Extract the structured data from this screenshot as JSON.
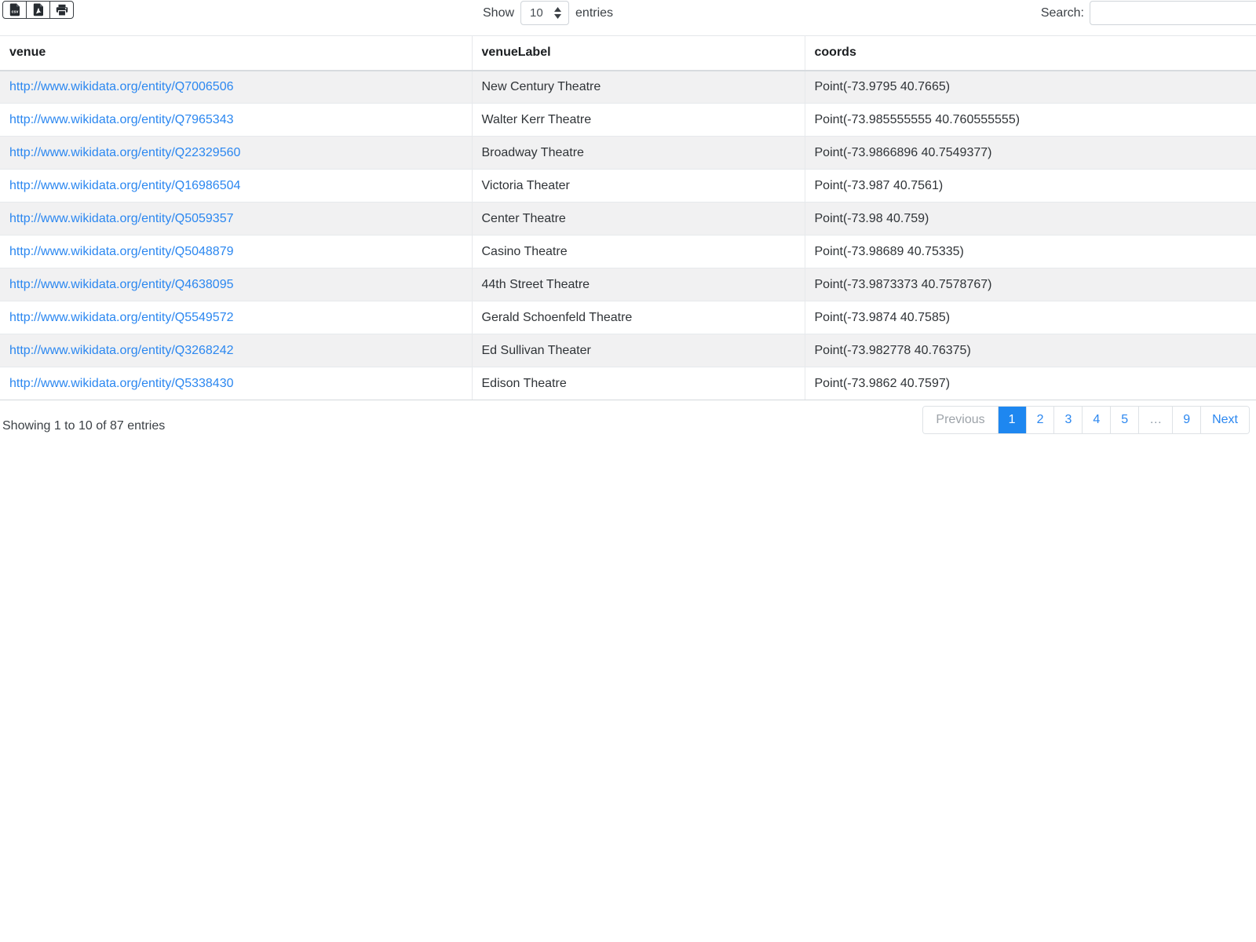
{
  "toolbar": {
    "buttons": [
      {
        "name": "csv",
        "icon": "file-csv-icon"
      },
      {
        "name": "pdf",
        "icon": "file-pdf-icon"
      },
      {
        "name": "print",
        "icon": "print-icon"
      }
    ],
    "length_control": {
      "prefix": "Show",
      "selected": "10",
      "suffix": "entries"
    },
    "search": {
      "label": "Search:",
      "value": "",
      "placeholder": ""
    }
  },
  "table": {
    "columns": [
      "venue",
      "venueLabel",
      "coords"
    ],
    "rows": [
      {
        "venue": "http://www.wikidata.org/entity/Q7006506",
        "venueLabel": "New Century Theatre",
        "coords": "Point(-73.9795 40.7665)"
      },
      {
        "venue": "http://www.wikidata.org/entity/Q7965343",
        "venueLabel": "Walter Kerr Theatre",
        "coords": "Point(-73.985555555 40.760555555)"
      },
      {
        "venue": "http://www.wikidata.org/entity/Q22329560",
        "venueLabel": "Broadway Theatre",
        "coords": "Point(-73.9866896 40.7549377)"
      },
      {
        "venue": "http://www.wikidata.org/entity/Q16986504",
        "venueLabel": "Victoria Theater",
        "coords": "Point(-73.987 40.7561)"
      },
      {
        "venue": "http://www.wikidata.org/entity/Q5059357",
        "venueLabel": "Center Theatre",
        "coords": "Point(-73.98 40.759)"
      },
      {
        "venue": "http://www.wikidata.org/entity/Q5048879",
        "venueLabel": "Casino Theatre",
        "coords": "Point(-73.98689 40.75335)"
      },
      {
        "venue": "http://www.wikidata.org/entity/Q4638095",
        "venueLabel": "44th Street Theatre",
        "coords": "Point(-73.9873373 40.7578767)"
      },
      {
        "venue": "http://www.wikidata.org/entity/Q5549572",
        "venueLabel": "Gerald Schoenfeld Theatre",
        "coords": "Point(-73.9874 40.7585)"
      },
      {
        "venue": "http://www.wikidata.org/entity/Q3268242",
        "venueLabel": "Ed Sullivan Theater",
        "coords": "Point(-73.982778 40.76375)"
      },
      {
        "venue": "http://www.wikidata.org/entity/Q5338430",
        "venueLabel": "Edison Theatre",
        "coords": "Point(-73.9862 40.7597)"
      }
    ]
  },
  "footer": {
    "info": "Showing 1 to 10 of 87 entries",
    "pagination": {
      "previous": "Previous",
      "pages": [
        "1",
        "2",
        "3",
        "4",
        "5",
        "…",
        "9"
      ],
      "active_page": "1",
      "next": "Next"
    }
  },
  "colors": {
    "accent": "#1e87f0",
    "link": "#2b87f0",
    "stripe": "#f1f1f2",
    "border": "#dee2e6"
  }
}
